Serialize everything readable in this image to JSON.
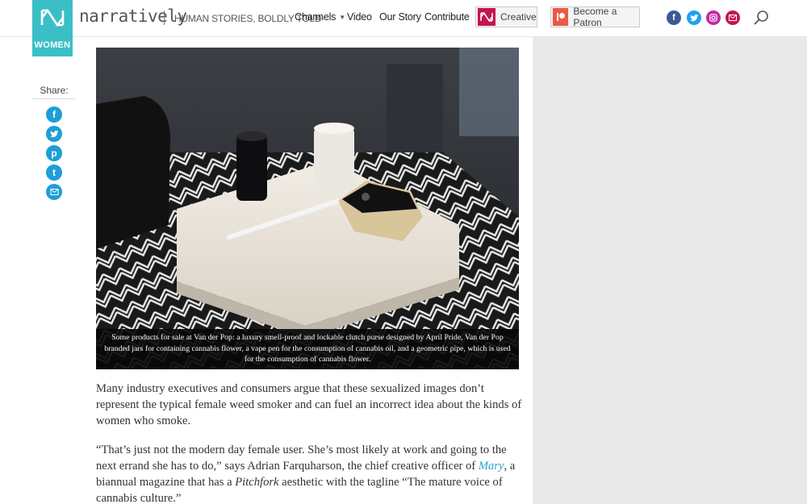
{
  "header": {
    "brand": "narratively",
    "tagline": "HUMAN STORIES, BOLDLY TOLD",
    "section": "WOMEN",
    "nav": {
      "channels": "Channels",
      "video": "Video",
      "our_story": "Our Story",
      "contribute": "Contribute"
    },
    "creative_label": "Creative",
    "patron_label": "Become a Patron",
    "social": [
      "facebook-icon",
      "twitter-icon",
      "instagram-icon",
      "email-icon"
    ]
  },
  "share": {
    "label": "Share:",
    "icons": [
      "facebook-icon",
      "twitter-icon",
      "pinterest-icon",
      "tumblr-icon",
      "email-icon"
    ]
  },
  "photo": {
    "caption": "Some products for sale at Van der Pop: a luxury smell-proof and lockable clutch purse designed by April Pride, Van der Pop branded jars for containing cannabis flower, a vape pen for the consumption of cannabis oil, and a geometric pipe, which is used for the consumption of cannabis flower."
  },
  "article": {
    "p1": "Many industry executives and consumers argue that these sexualized images don’t represent the typical female weed smoker and can fuel an incorrect idea about the kinds of women who smoke.",
    "p2_a": "“That’s just not the modern day female user. She’s most likely at work and going to the next errand she has to do,” says Adrian Farquharson, the chief creative officer of ",
    "p2_link": "Mary",
    "p2_b": ", a biannual magazine that has a ",
    "p2_em": "Pitchfork",
    "p2_c": " aesthetic with the tagline “The mature voice of cannabis culture.”"
  },
  "colors": {
    "brand_teal": "#3bbfc6",
    "share_blue": "#1d9fd8",
    "creative_red": "#c4154f",
    "patron_orange": "#e85b46",
    "link_blue": "#2aa4cf"
  }
}
